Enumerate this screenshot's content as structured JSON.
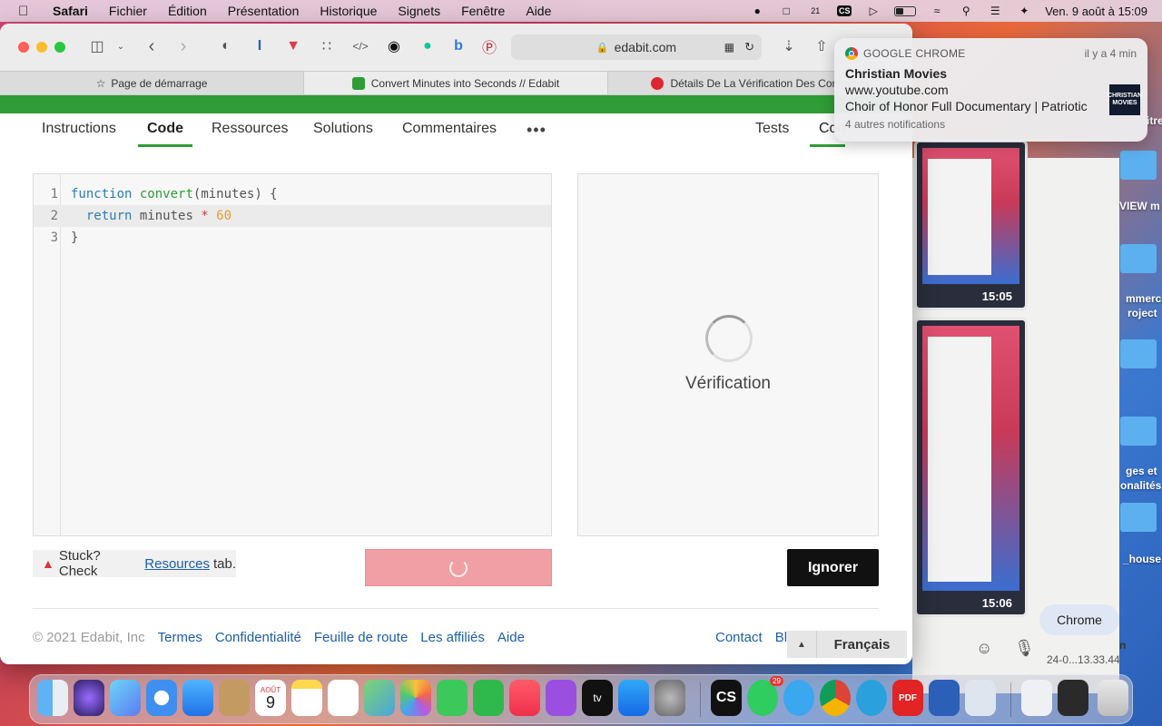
{
  "menubar": {
    "app": "Safari",
    "items": [
      "Fichier",
      "Édition",
      "Présentation",
      "Historique",
      "Signets",
      "Fenêtre",
      "Aide"
    ],
    "datetime": "Ven. 9 août à  15:09",
    "cs_label": "CS",
    "calendar_badge": "21"
  },
  "browser": {
    "address": "edabit.com",
    "tabs": [
      {
        "label": "Page de démarrage"
      },
      {
        "label": "Convert Minutes into Seconds // Edabit"
      },
      {
        "label": "Détails De La Vérification Des Compéten"
      }
    ]
  },
  "subnav": {
    "items": [
      "Instructions",
      "Code",
      "Ressources",
      "Solutions",
      "Commentaires"
    ],
    "more": "•••",
    "right_items": [
      "Tests",
      "Con"
    ]
  },
  "editor": {
    "lines": [
      "1",
      "2",
      "3"
    ],
    "code": {
      "l1_kw": "function",
      "l1_fn": "convert",
      "l1_rest": "(minutes) {",
      "l2_kw": "return",
      "l2_mid": " minutes ",
      "l2_op": "*",
      "l2_num": "60",
      "l3": "}"
    }
  },
  "results": {
    "status": "Vérification"
  },
  "actions": {
    "stuck_prefix": "Stuck? Check",
    "stuck_link": "Resources",
    "stuck_suffix": "tab.",
    "ignore": "Ignorer"
  },
  "footer": {
    "copyright": "© 2021 Edabit, Inc",
    "links": [
      "Termes",
      "Confidentialité",
      "Feuille de route",
      "Les affiliés",
      "Aide"
    ],
    "right_links": [
      "Contact",
      "Bl"
    ],
    "language": "Français"
  },
  "notification": {
    "app": "GOOGLE CHROME",
    "when": "il y a 4 min",
    "title": "Christian Movies",
    "line1": "www.youtube.com",
    "line2": "Choir of Honor Full Documentary | Patriotic",
    "more": "4 autres notifications",
    "thumb": "CHRISTIAN MOVIES"
  },
  "desktop": {
    "thumb_times": [
      "15:05",
      "15:06"
    ],
    "chrome_chip": "Chrome",
    "labels": [
      "itre",
      "VIEW m",
      "mmerc",
      "roject",
      "ges et",
      "onalités",
      "_house",
      "n",
      "24-0...13.33.44"
    ]
  },
  "dock": {
    "calendar_month": "AOÛT",
    "calendar_day": "9",
    "whatsapp_badge": "29",
    "cs": "CS",
    "pdf": "PDF",
    "appletv": "tv"
  },
  "colors": {
    "edabit_green": "#2f9c37",
    "link_blue": "#1d5fa6",
    "submit_pink": "#f0a0a4"
  }
}
